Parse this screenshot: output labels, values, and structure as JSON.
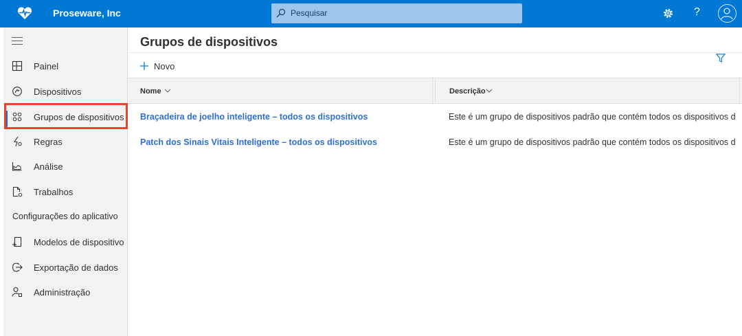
{
  "app": {
    "brand_name": "Proseware, Inc",
    "brand_icon": "heart-pulse-icon",
    "accent_color": "#0078d4"
  },
  "search": {
    "placeholder": "Pesquisar"
  },
  "header_actions": {
    "settings_icon": "gear-icon",
    "help_text": "?",
    "avatar_icon": "user-avatar-icon"
  },
  "sidebar": {
    "items": [
      {
        "label": "Painel",
        "icon": "dashboard-icon"
      },
      {
        "label": "Dispositivos",
        "icon": "devices-icon"
      },
      {
        "label": "Grupos de dispositivos",
        "icon": "device-groups-icon",
        "active": true
      },
      {
        "label": "Regras",
        "icon": "rules-icon"
      },
      {
        "label": "Análise",
        "icon": "analytics-icon"
      },
      {
        "label": "Trabalhos",
        "icon": "jobs-icon"
      }
    ],
    "section_title": "Configurações do aplicativo",
    "app_items": [
      {
        "label": "Modelos de dispositivo",
        "icon": "device-templates-icon"
      },
      {
        "label": "Exportação de dados",
        "icon": "data-export-icon"
      },
      {
        "label": "Administração",
        "icon": "administration-icon"
      }
    ]
  },
  "main": {
    "title": "Grupos de dispositivos",
    "new_label": "Novo",
    "table": {
      "columns": [
        "Nome",
        "Descrição"
      ],
      "rows": [
        {
          "name": "Braçadeira de joelho inteligente – todos os dispositivos",
          "description": "Este é um grupo de dispositivos padrão que contém todos os dispositivos d"
        },
        {
          "name": "Patch dos Sinais Vitais Inteligente – todos os dispositivos",
          "description": "Este é um grupo de dispositivos padrão que contém todos os dispositivos d"
        }
      ]
    }
  }
}
